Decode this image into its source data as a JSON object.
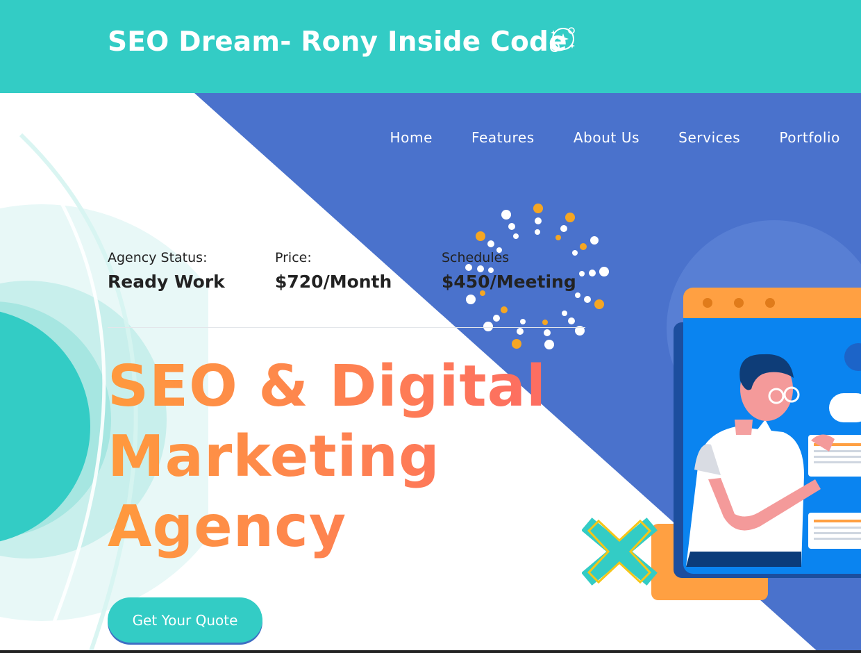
{
  "header": {
    "title": "SEO Dream- Rony Inside Code",
    "logo_icon": "sparkle-planet-icon"
  },
  "nav": {
    "items": [
      "Home",
      "Features",
      "About Us",
      "Services",
      "Portfolio"
    ]
  },
  "stats": [
    {
      "label": "Agency Status:",
      "value": "Ready Work"
    },
    {
      "label": "Price:",
      "value": "$720/Month"
    },
    {
      "label": "Schedules",
      "value": "$450/Meeting"
    }
  ],
  "hero": {
    "headline_lines": [
      "SEO & Digital",
      "Marketing",
      "Agency"
    ],
    "cta_label": "Get Your Quote"
  },
  "colors": {
    "header_bg": "#33ccc5",
    "hero_blue": "#4a72cc",
    "headline_gradient_start": "#ff9a3d",
    "headline_gradient_end": "#fd6d62",
    "cta_bg": "#33ccc5",
    "accent_orange": "#ffa042"
  }
}
